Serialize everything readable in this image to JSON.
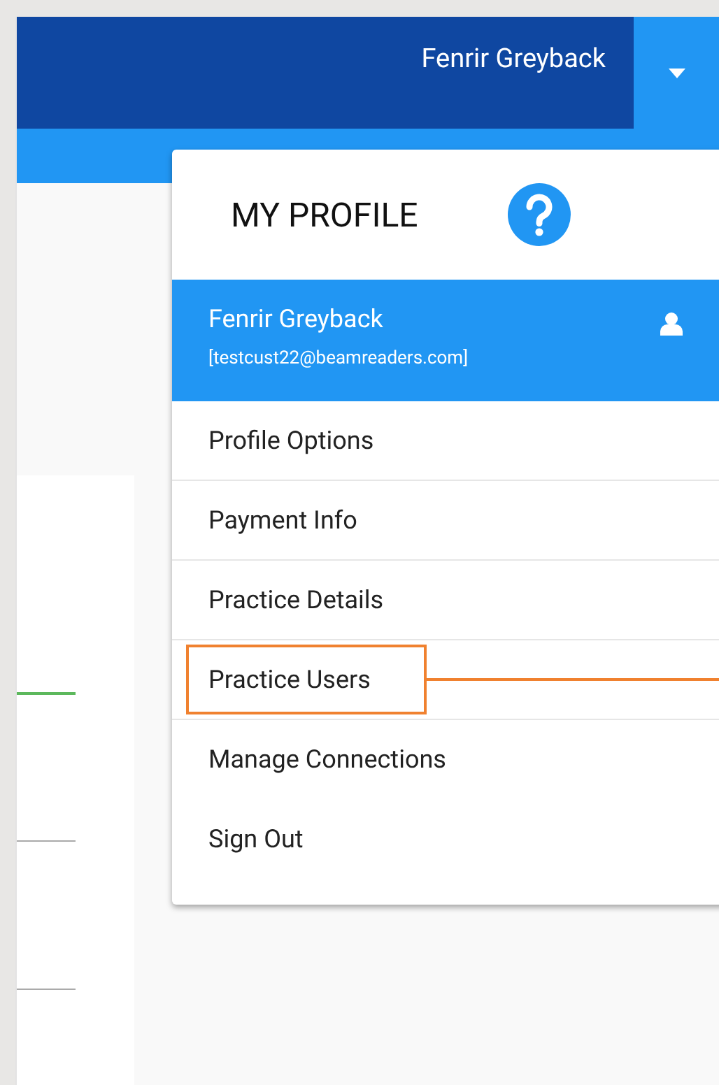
{
  "header": {
    "user_name": "Fenrir Greyback"
  },
  "profile_menu": {
    "title": "MY PROFILE",
    "user": {
      "name": "Fenrir Greyback",
      "email": "[testcust22@beamreaders.com]"
    },
    "items": [
      {
        "label": "Profile Options",
        "divider": true,
        "highlighted": false
      },
      {
        "label": "Payment Info",
        "divider": true,
        "highlighted": false
      },
      {
        "label": "Practice Details",
        "divider": true,
        "highlighted": false
      },
      {
        "label": "Practice Users",
        "divider": true,
        "highlighted": true
      },
      {
        "label": "Manage Connections",
        "divider": false,
        "highlighted": false
      },
      {
        "label": "Sign Out",
        "divider": false,
        "highlighted": false
      }
    ]
  }
}
